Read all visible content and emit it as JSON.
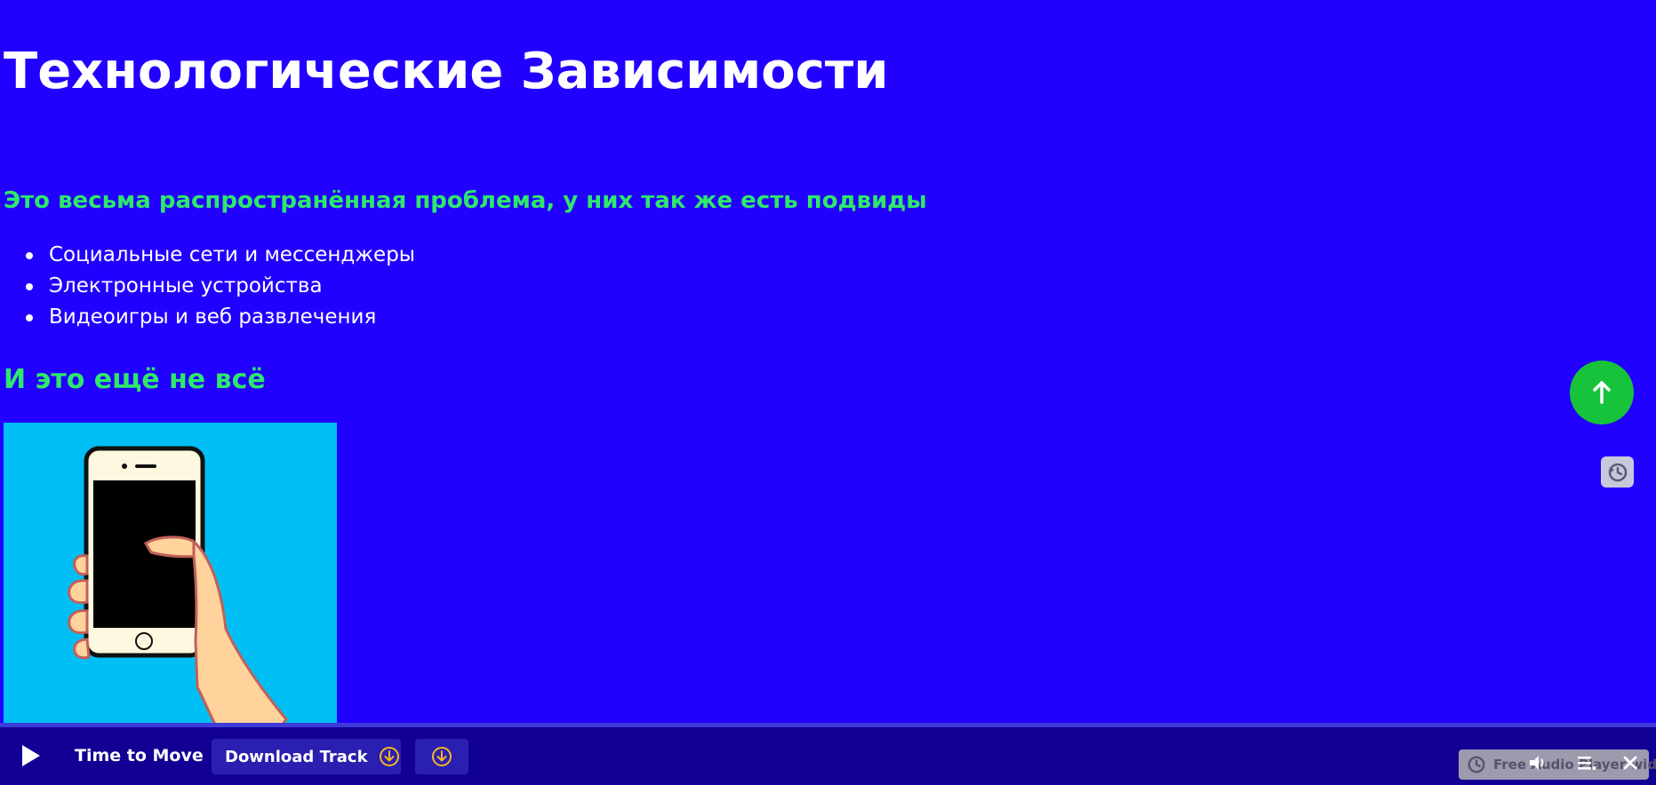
{
  "page": {
    "title": "Технологические Зависимости",
    "subtitle": "Это весьма распространённая проблема, у них так же есть подвиды",
    "items": [
      "Социальные сети и мессенджеры",
      "Электронные устройства",
      "Видеоигры и веб развлечения"
    ],
    "subtitle2": "И это ещё не всё"
  },
  "colors": {
    "background": "#2200ff",
    "heading_accent": "#2ee86a",
    "scroll_top_button": "#16c33a",
    "player_bar": "#120094",
    "download_icon": "#f5b81c",
    "picture_background": "#00bff5"
  },
  "image": {
    "subject": "hand-holding-smartphone"
  },
  "scroll_top": {
    "icon": "arrow-up-icon"
  },
  "player": {
    "track_title": "Time to Move",
    "download_label": "Download Track",
    "widget_label": "Free Audio Player widget",
    "icons": [
      "play-icon",
      "download-icon",
      "volume-icon",
      "playlist-icon",
      "close-icon"
    ]
  }
}
